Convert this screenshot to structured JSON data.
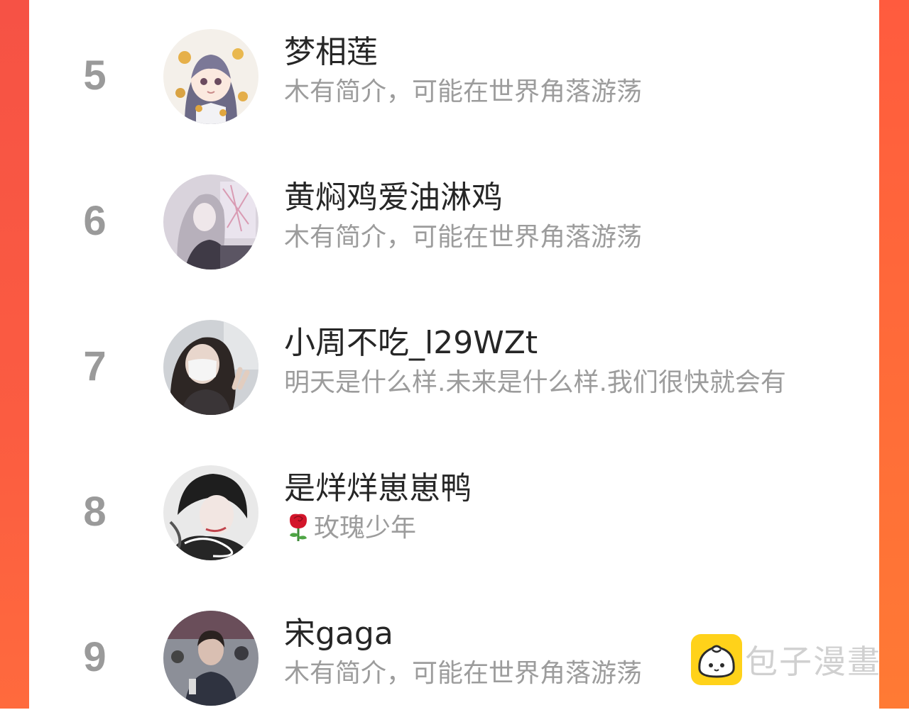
{
  "colors": {
    "rank": "#9a9a9a",
    "name": "#262626",
    "bio": "#9c9c9c",
    "frame_left": "#f65245",
    "frame_right": "#ff7a34",
    "logo": "#ffd21a"
  },
  "list": {
    "items": [
      {
        "rank": "5",
        "name": "梦相莲",
        "bio": "木有简介，可能在世界角落游荡"
      },
      {
        "rank": "6",
        "name": "黄焖鸡爱油淋鸡",
        "bio": "木有简介，可能在世界角落游荡"
      },
      {
        "rank": "7",
        "name": "小周不吃_l29WZt",
        "bio": "明天是什么样.未来是什么样.我们很快就会有"
      },
      {
        "rank": "8",
        "name": "是烊烊崽崽鸭",
        "bio": "玫瑰少年",
        "bio_icon": "rose-icon"
      },
      {
        "rank": "9",
        "name": "宋gaga",
        "bio": "木有简介，可能在世界角落游荡"
      }
    ]
  },
  "watermark": {
    "text": "包子漫畫",
    "icon": "bun-logo-icon"
  }
}
